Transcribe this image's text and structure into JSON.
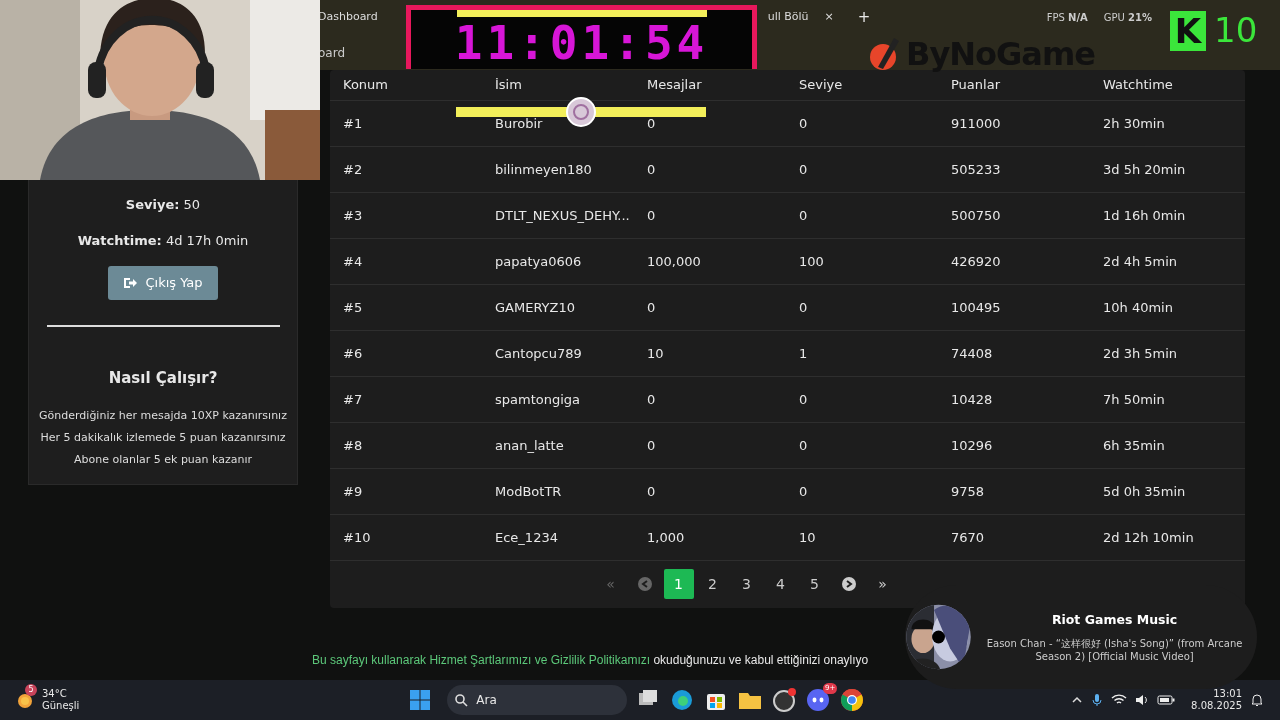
{
  "browser": {
    "tabs": [
      {
        "title": "Dashboard",
        "closable": false
      },
      {
        "title": "ull Bölü",
        "closable": true,
        "close_label": "×"
      }
    ],
    "new_tab": "+",
    "address": "oard",
    "stats": [
      {
        "label": "FPS",
        "value": "N/A"
      },
      {
        "label": "GPU",
        "value": "21%"
      }
    ]
  },
  "profile": {
    "stats": [
      {
        "label": "Seviye:",
        "value": "50"
      },
      {
        "label": "Watchtime:",
        "value": "4d 17h 0min"
      }
    ],
    "logout": "Çıkış Yap",
    "how_title": "Nasıl Çalışır?",
    "how_lines": [
      "Gönderdiğiniz her mesajda 10XP kazanırsınız",
      "Her 5 dakikalık izlemede 5 puan kazanırsınız",
      "Abone olanlar 5 ek puan kazanır"
    ]
  },
  "table": {
    "columns": [
      "Konum",
      "İsim",
      "Mesajlar",
      "Seviye",
      "Puanlar",
      "Watchtime"
    ],
    "rows": [
      [
        "#1",
        "Burobir",
        "0",
        "0",
        "911000",
        "2h 30min"
      ],
      [
        "#2",
        "bilinmeyen180",
        "0",
        "0",
        "505233",
        "3d 5h 20min"
      ],
      [
        "#3",
        "DTLT_NEXUS_DEHY...",
        "0",
        "0",
        "500750",
        "1d 16h 0min"
      ],
      [
        "#4",
        "papatya0606",
        "100,000",
        "100",
        "426920",
        "2d 4h 5min"
      ],
      [
        "#5",
        "GAMERYZ10",
        "0",
        "0",
        "100495",
        "10h 40min"
      ],
      [
        "#6",
        "Cantopcu789",
        "10",
        "1",
        "74408",
        "2d 3h 5min"
      ],
      [
        "#7",
        "spamtongiga",
        "0",
        "0",
        "10428",
        "7h 50min"
      ],
      [
        "#8",
        "anan_latte",
        "0",
        "0",
        "10296",
        "6h 35min"
      ],
      [
        "#9",
        "ModBotTR",
        "0",
        "0",
        "9758",
        "5d 0h 35min"
      ],
      [
        "#10",
        "Ece_1234",
        "1,000",
        "10",
        "7670",
        "2d 12h 10min"
      ]
    ]
  },
  "pagination": [
    {
      "kind": "first",
      "label": "«",
      "disabled": true
    },
    {
      "kind": "prev",
      "disabled": true
    },
    {
      "kind": "page",
      "label": "1",
      "selected": true
    },
    {
      "kind": "page",
      "label": "2",
      "selected": false
    },
    {
      "kind": "page",
      "label": "3",
      "selected": false
    },
    {
      "kind": "page",
      "label": "4",
      "selected": false
    },
    {
      "kind": "page",
      "label": "5",
      "selected": false
    },
    {
      "kind": "next",
      "disabled": false
    },
    {
      "kind": "last",
      "label": "»",
      "disabled": false
    }
  ],
  "footer": {
    "link": "Bu sayfayı kullanarak Hizmet Şartlarımızı ve Gizlilik Politikamızı",
    "text": "okuduğunuzu ve kabul ettiğinizi onaylıyo"
  },
  "overlays": {
    "timer": "11:01:54",
    "logo": "ByNoGame",
    "counter": {
      "letter": "K",
      "value": "10"
    },
    "music": {
      "title": "Riot Games Music",
      "track": "Eason Chan - “这样很好 (Isha's Song)” (from Arcane Season 2) [Official Music Video]"
    }
  },
  "taskbar": {
    "weather": {
      "badge": "5",
      "temp": "34°C",
      "condition": "Güneşli"
    },
    "search": "Ara",
    "discord_badge": "9+",
    "time": "13:01",
    "date": "8.08.2025"
  }
}
